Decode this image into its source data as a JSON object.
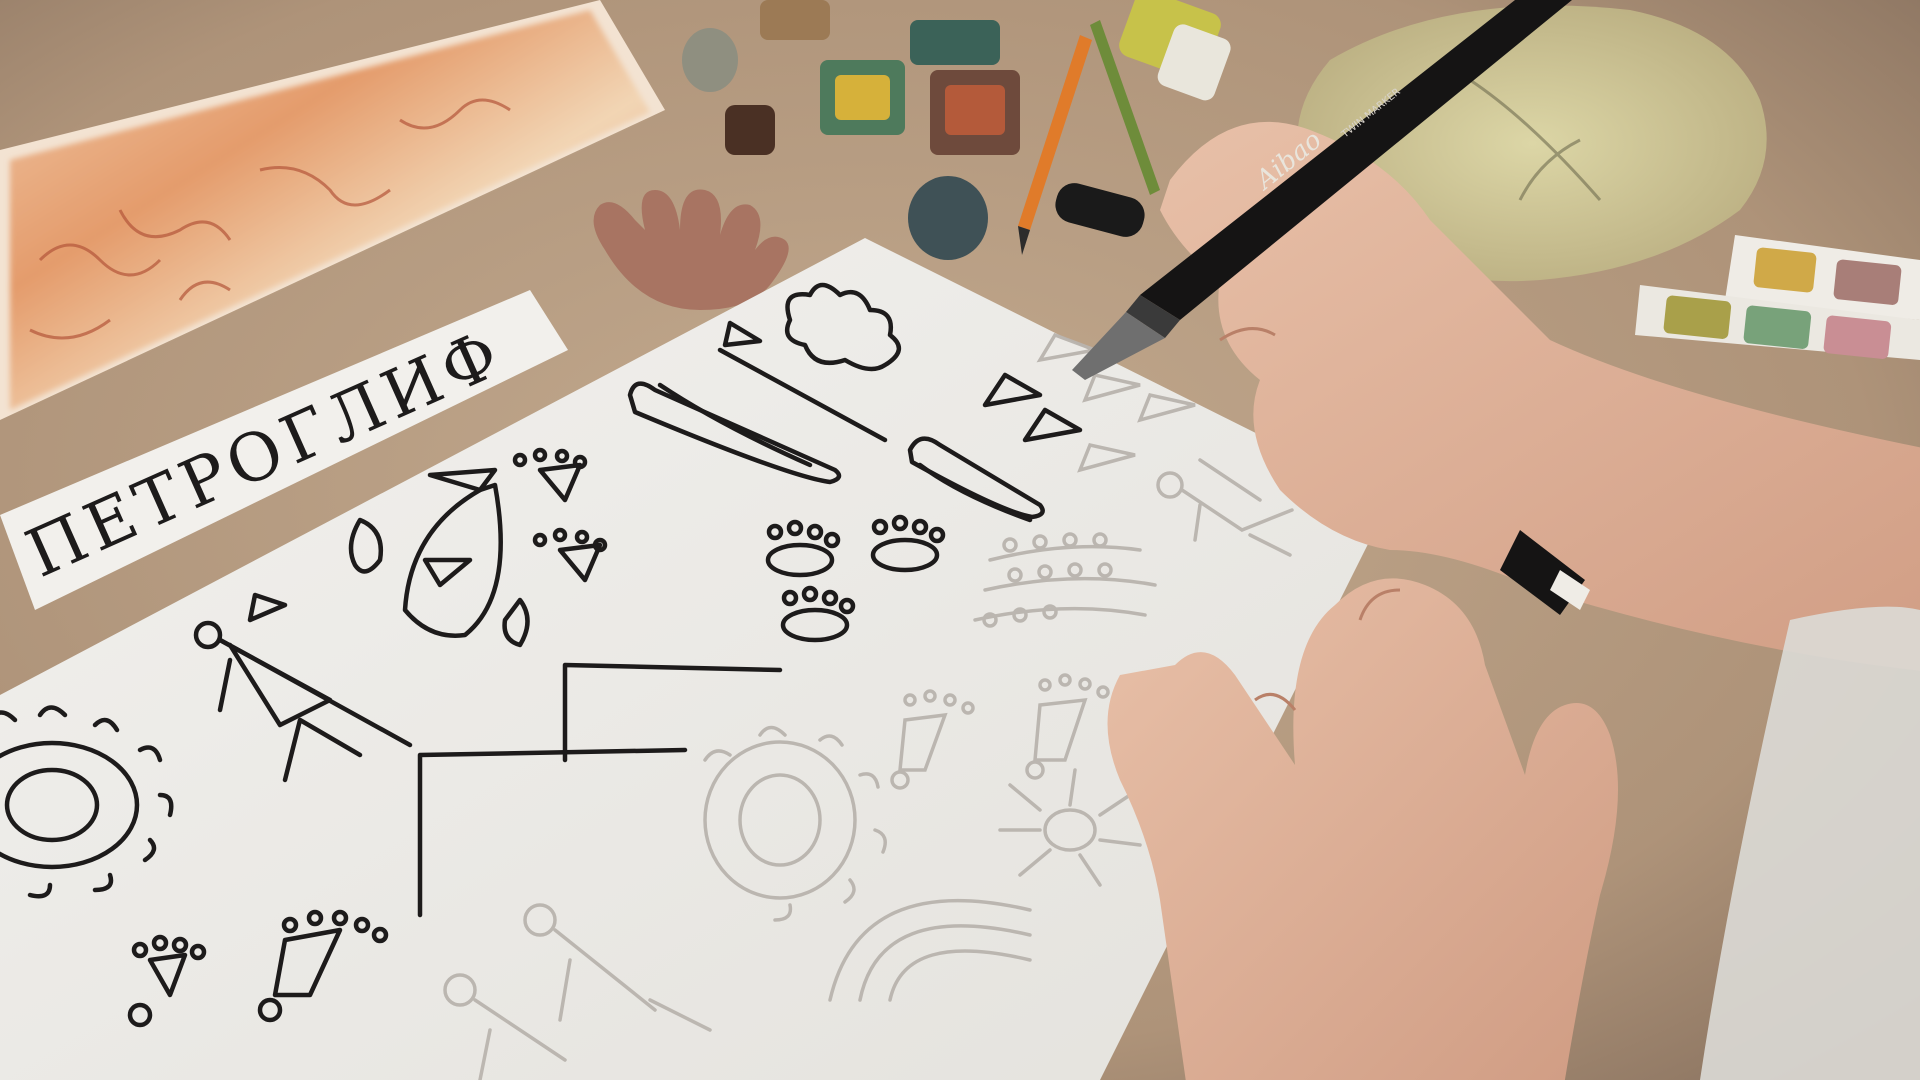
{
  "image": {
    "label_text": "ПЕТРОГЛИФ",
    "pen_brand": "Aibao",
    "pen_caption": "TWIN MARKER",
    "colors": {
      "table": "#b79e84",
      "paper": "#ecebe7",
      "ink": "#1d1b1b",
      "pencil": "#b9b4ae",
      "skin": "#e0b49c",
      "pen_body": "#151414",
      "watercolor_warm": "#d98a5c",
      "watercolor_green": "#c9c39a"
    }
  }
}
